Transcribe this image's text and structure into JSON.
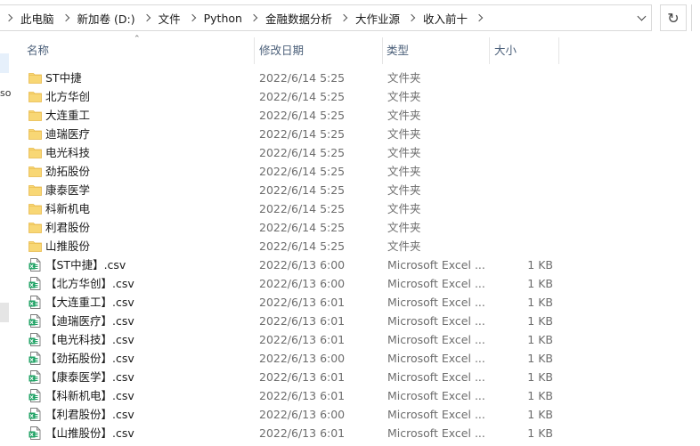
{
  "address_bar": {
    "crumbs": [
      "此电脑",
      "新加卷 (D:)",
      "文件",
      "Python",
      "金融数据分析",
      "大作业源",
      "收入前十"
    ]
  },
  "nav_pane": {
    "fragment": "so"
  },
  "columns": {
    "name": "名称",
    "date": "修改日期",
    "type": "类型",
    "size": "大小"
  },
  "files": [
    {
      "name": "ST中捷",
      "date": "2022/6/14 5:25",
      "type": "文件夹",
      "size": "",
      "icon": "folder-icon"
    },
    {
      "name": "北方华创",
      "date": "2022/6/14 5:25",
      "type": "文件夹",
      "size": "",
      "icon": "folder-icon"
    },
    {
      "name": "大连重工",
      "date": "2022/6/14 5:25",
      "type": "文件夹",
      "size": "",
      "icon": "folder-icon"
    },
    {
      "name": "迪瑞医疗",
      "date": "2022/6/14 5:25",
      "type": "文件夹",
      "size": "",
      "icon": "folder-icon"
    },
    {
      "name": "电光科技",
      "date": "2022/6/14 5:25",
      "type": "文件夹",
      "size": "",
      "icon": "folder-icon"
    },
    {
      "name": "劲拓股份",
      "date": "2022/6/14 5:25",
      "type": "文件夹",
      "size": "",
      "icon": "folder-icon"
    },
    {
      "name": "康泰医学",
      "date": "2022/6/14 5:25",
      "type": "文件夹",
      "size": "",
      "icon": "folder-icon"
    },
    {
      "name": "科新机电",
      "date": "2022/6/14 5:25",
      "type": "文件夹",
      "size": "",
      "icon": "folder-icon"
    },
    {
      "name": "利君股份",
      "date": "2022/6/14 5:25",
      "type": "文件夹",
      "size": "",
      "icon": "folder-icon"
    },
    {
      "name": "山推股份",
      "date": "2022/6/14 5:25",
      "type": "文件夹",
      "size": "",
      "icon": "folder-icon"
    },
    {
      "name": "【ST中捷】.csv",
      "date": "2022/6/13 6:00",
      "type": "Microsoft Excel ...",
      "size": "1 KB",
      "icon": "csv-file-icon"
    },
    {
      "name": "【北方华创】.csv",
      "date": "2022/6/13 6:00",
      "type": "Microsoft Excel ...",
      "size": "1 KB",
      "icon": "csv-file-icon"
    },
    {
      "name": "【大连重工】.csv",
      "date": "2022/6/13 6:01",
      "type": "Microsoft Excel ...",
      "size": "1 KB",
      "icon": "csv-file-icon"
    },
    {
      "name": "【迪瑞医疗】.csv",
      "date": "2022/6/13 6:01",
      "type": "Microsoft Excel ...",
      "size": "1 KB",
      "icon": "csv-file-icon"
    },
    {
      "name": "【电光科技】.csv",
      "date": "2022/6/13 6:01",
      "type": "Microsoft Excel ...",
      "size": "1 KB",
      "icon": "csv-file-icon"
    },
    {
      "name": "【劲拓股份】.csv",
      "date": "2022/6/13 6:00",
      "type": "Microsoft Excel ...",
      "size": "1 KB",
      "icon": "csv-file-icon"
    },
    {
      "name": "【康泰医学】.csv",
      "date": "2022/6/13 6:01",
      "type": "Microsoft Excel ...",
      "size": "1 KB",
      "icon": "csv-file-icon"
    },
    {
      "name": "【科新机电】.csv",
      "date": "2022/6/13 6:01",
      "type": "Microsoft Excel ...",
      "size": "1 KB",
      "icon": "csv-file-icon"
    },
    {
      "name": "【利君股份】.csv",
      "date": "2022/6/13 6:00",
      "type": "Microsoft Excel ...",
      "size": "1 KB",
      "icon": "csv-file-icon"
    },
    {
      "name": "【山推股份】.csv",
      "date": "2022/6/13 6:01",
      "type": "Microsoft Excel ...",
      "size": "1 KB",
      "icon": "csv-file-icon"
    }
  ],
  "colors": {
    "folder": "#f8d775",
    "folder_tab": "#e8b94a",
    "csv_green": "#21a366",
    "header_text": "#4c607a"
  }
}
